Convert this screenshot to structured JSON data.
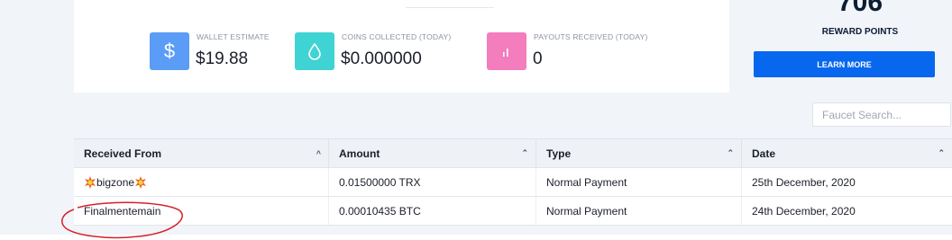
{
  "stats": [
    {
      "label": "WALLET ESTIMATE",
      "value": "$19.88",
      "icon": "dollar-icon",
      "color": "#5b9cf6"
    },
    {
      "label": "COINS COLLECTED (TODAY)",
      "value": "$0.000000",
      "icon": "droplet-icon",
      "color": "#3fd3d3"
    },
    {
      "label": "PAYOUTS RECEIVED (TODAY)",
      "value": "0",
      "icon": "bar-chart-icon",
      "color": "#f37dbd"
    }
  ],
  "reward": {
    "points": "706",
    "label": "REWARD POINTS",
    "button": "LEARN MORE",
    "button_color": "#0767ef"
  },
  "search": {
    "placeholder": "Faucet Search..."
  },
  "table": {
    "headers": [
      "Received From",
      "Amount",
      "Type",
      "Date"
    ],
    "rows": [
      {
        "from": "bigzone",
        "amount": "0.01500000 TRX",
        "type": "Normal Payment",
        "date": "25th December, 2020"
      },
      {
        "from": "Finalmentemain",
        "amount": "0.00010435 BTC",
        "type": "Normal Payment",
        "date": "24th December, 2020"
      }
    ]
  },
  "colors": {
    "accent": "#0767ef",
    "annotation": "#d8202a"
  }
}
